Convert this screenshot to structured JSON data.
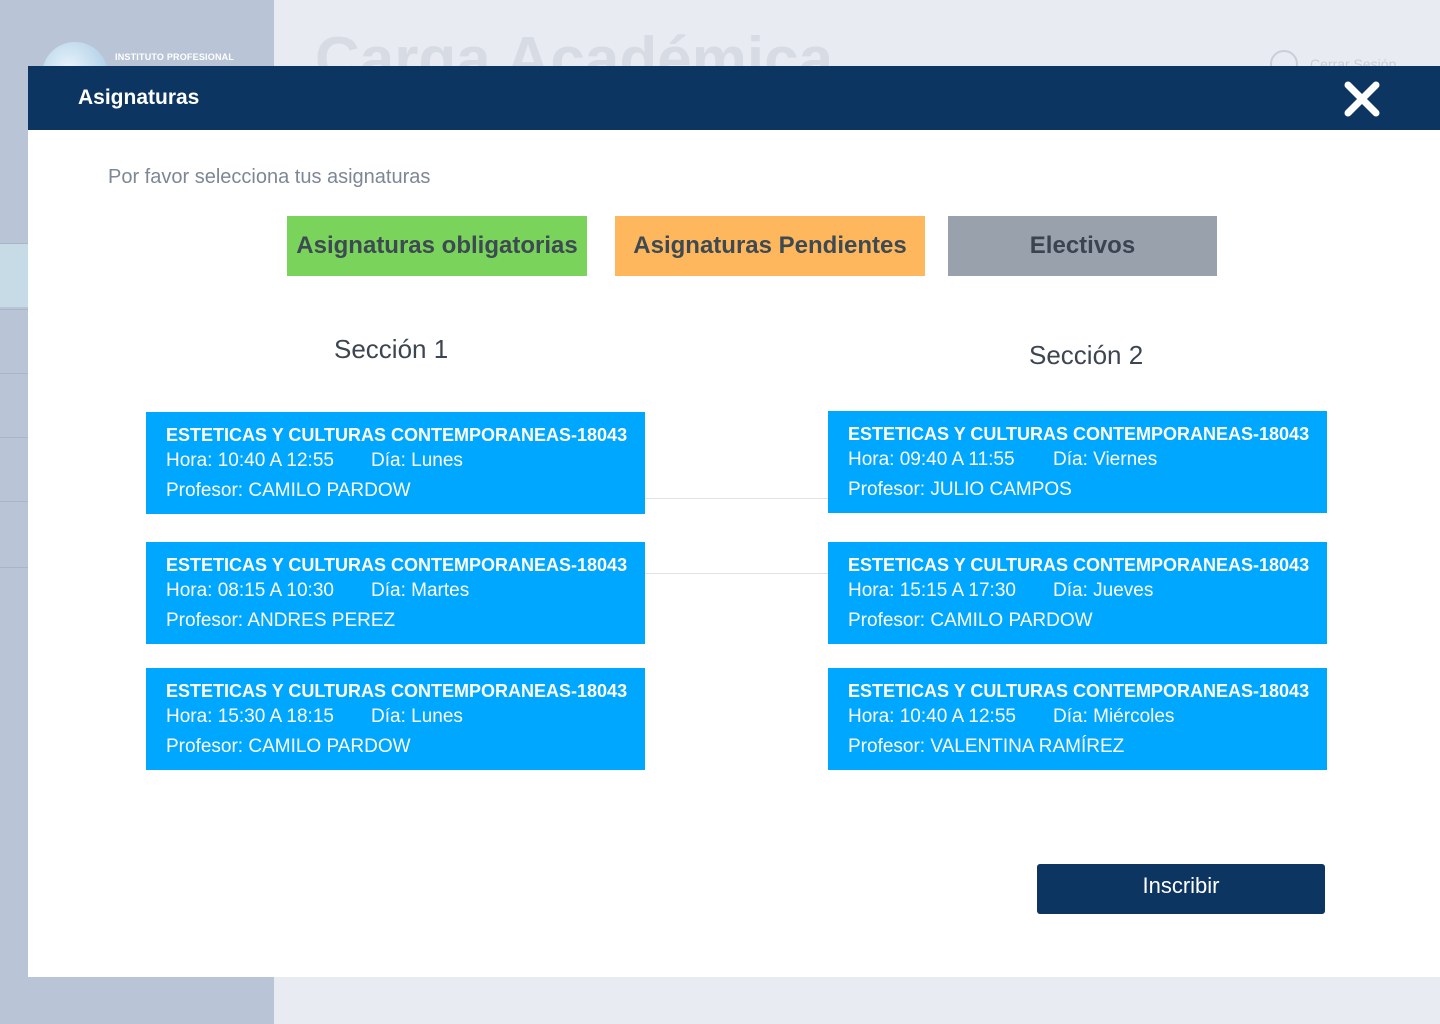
{
  "background": {
    "logo_text": "INSTITUTO PROFESIONAL",
    "page_title": "Carga Académica",
    "logout_label": "Cerrar Sesión"
  },
  "modal": {
    "title": "Asignaturas",
    "instruction": "Por favor selecciona tus asignaturas",
    "tabs": [
      {
        "label": "Asignaturas obligatorias",
        "color": "#7ad45b"
      },
      {
        "label": "Asignaturas Pendientes",
        "color": "#ffb75e"
      },
      {
        "label": "Electivos",
        "color": "#99a1ad"
      }
    ],
    "sections": [
      {
        "title": "Sección 1",
        "courses": [
          {
            "code": "ESTETICAS Y CULTURAS  CONTEMPORANEAS-18043",
            "hora": "Hora: 10:40 A 12:55",
            "dia": "Día: Lunes",
            "profesor": "Profesor: CAMILO PARDOW"
          },
          {
            "code": "ESTETICAS Y CULTURAS  CONTEMPORANEAS-18043",
            "hora": "Hora: 08:15 A 10:30",
            "dia": "Día: Martes",
            "profesor": "Profesor:  ANDRES PEREZ"
          },
          {
            "code": "ESTETICAS Y CULTURAS  CONTEMPORANEAS-18043",
            "hora": "Hora: 15:30 A 18:15",
            "dia": "Día: Lunes",
            "profesor": "Profesor: CAMILO PARDOW"
          }
        ]
      },
      {
        "title": "Sección 2",
        "courses": [
          {
            "code": "ESTETICAS Y CULTURAS  CONTEMPORANEAS-18043",
            "hora": "Hora: 09:40 A 11:55",
            "dia": "Día: Viernes",
            "profesor": "Profesor: JULIO CAMPOS"
          },
          {
            "code": "ESTETICAS Y CULTURAS  CONTEMPORANEAS-18043",
            "hora": "Hora: 15:15 A 17:30",
            "dia": "Día: Jueves",
            "profesor": "Profesor: CAMILO PARDOW"
          },
          {
            "code": "ESTETICAS Y CULTURAS  CONTEMPORANEAS-18043",
            "hora": "Hora: 10:40 A 12:55",
            "dia": "Día: Miércoles",
            "profesor": "Profesor: VALENTINA RAMÍREZ"
          }
        ]
      }
    ],
    "submit_label": "Inscribir"
  },
  "colors": {
    "header": "#0d3562",
    "card": "#00a7ff"
  }
}
